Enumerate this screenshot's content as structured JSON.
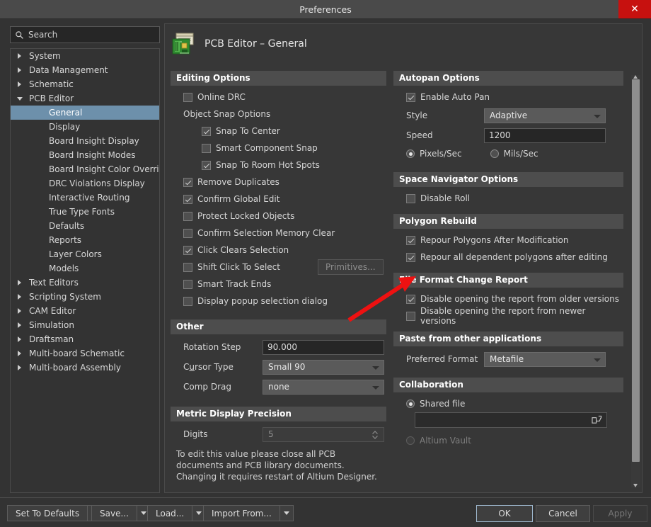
{
  "window": {
    "title": "Preferences",
    "close_label": "✕"
  },
  "search": {
    "placeholder": "Search",
    "value": "",
    "icon": "search-icon"
  },
  "sidebar": {
    "items": [
      {
        "label": "System",
        "level": 0,
        "expander": "closed",
        "selected": false
      },
      {
        "label": "Data Management",
        "level": 0,
        "expander": "closed",
        "selected": false
      },
      {
        "label": "Schematic",
        "level": 0,
        "expander": "closed",
        "selected": false
      },
      {
        "label": "PCB Editor",
        "level": 0,
        "expander": "open",
        "selected": false
      },
      {
        "label": "General",
        "level": 1,
        "expander": "none",
        "selected": true
      },
      {
        "label": "Display",
        "level": 1,
        "expander": "none",
        "selected": false
      },
      {
        "label": "Board Insight Display",
        "level": 1,
        "expander": "none",
        "selected": false
      },
      {
        "label": "Board Insight Modes",
        "level": 1,
        "expander": "none",
        "selected": false
      },
      {
        "label": "Board Insight Color Overrides",
        "level": 1,
        "expander": "none",
        "selected": false
      },
      {
        "label": "DRC Violations Display",
        "level": 1,
        "expander": "none",
        "selected": false
      },
      {
        "label": "Interactive Routing",
        "level": 1,
        "expander": "none",
        "selected": false
      },
      {
        "label": "True Type Fonts",
        "level": 1,
        "expander": "none",
        "selected": false
      },
      {
        "label": "Defaults",
        "level": 1,
        "expander": "none",
        "selected": false
      },
      {
        "label": "Reports",
        "level": 1,
        "expander": "none",
        "selected": false
      },
      {
        "label": "Layer Colors",
        "level": 1,
        "expander": "none",
        "selected": false
      },
      {
        "label": "Models",
        "level": 1,
        "expander": "none",
        "selected": false
      },
      {
        "label": "Text Editors",
        "level": 0,
        "expander": "closed",
        "selected": false
      },
      {
        "label": "Scripting System",
        "level": 0,
        "expander": "closed",
        "selected": false
      },
      {
        "label": "CAM Editor",
        "level": 0,
        "expander": "closed",
        "selected": false
      },
      {
        "label": "Simulation",
        "level": 0,
        "expander": "closed",
        "selected": false
      },
      {
        "label": "Draftsman",
        "level": 0,
        "expander": "closed",
        "selected": false
      },
      {
        "label": "Multi-board Schematic",
        "level": 0,
        "expander": "closed",
        "selected": false
      },
      {
        "label": "Multi-board Assembly",
        "level": 0,
        "expander": "closed",
        "selected": false
      }
    ]
  },
  "page": {
    "title": "PCB Editor – General",
    "icon": "pcb-board-icon"
  },
  "editing_options": {
    "header": "Editing Options",
    "online_drc": {
      "label": "Online DRC",
      "checked": false
    },
    "object_snap_label": "Object Snap Options",
    "snap_to_center": {
      "label": "Snap To Center",
      "checked": true
    },
    "smart_component_snap": {
      "label": "Smart Component Snap",
      "checked": false
    },
    "snap_to_room_hot_spots": {
      "label": "Snap To Room Hot Spots",
      "checked": true
    },
    "remove_duplicates": {
      "label": "Remove Duplicates",
      "checked": true
    },
    "confirm_global_edit": {
      "label": "Confirm Global Edit",
      "checked": true
    },
    "protect_locked_objects": {
      "label": "Protect Locked Objects",
      "checked": false
    },
    "confirm_selection_memory_clear": {
      "label": "Confirm Selection Memory Clear",
      "checked": false
    },
    "click_clears_selection": {
      "label": "Click Clears Selection",
      "checked": true
    },
    "shift_click_to_select": {
      "label": "Shift Click To Select",
      "checked": false
    },
    "primitives_button": {
      "label": "Primitives...",
      "enabled": false
    },
    "smart_track_ends": {
      "label": "Smart Track Ends",
      "checked": false
    },
    "display_popup_selection_dialog": {
      "label": "Display popup selection dialog",
      "checked": false
    }
  },
  "other": {
    "header": "Other",
    "rotation_step": {
      "label": "Rotation Step",
      "value": "90.000"
    },
    "cursor_type": {
      "label": "Cursor Type",
      "value": "Small 90"
    },
    "comp_drag": {
      "label": "Comp Drag",
      "value": "none"
    }
  },
  "metric_display_precision": {
    "header": "Metric Display Precision",
    "digits": {
      "label": "Digits",
      "value": "5",
      "enabled": false
    },
    "help_text": "To edit this value please close all PCB documents and PCB library documents. Changing it requires restart of Altium Designer."
  },
  "autopan_options": {
    "header": "Autopan Options",
    "enable_auto_pan": {
      "label": "Enable Auto Pan",
      "checked": true
    },
    "style": {
      "label": "Style",
      "value": "Adaptive"
    },
    "speed": {
      "label": "Speed",
      "value": "1200"
    },
    "pixels_per_sec": {
      "label": "Pixels/Sec",
      "selected": true
    },
    "mils_per_sec": {
      "label": "Mils/Sec",
      "selected": false
    }
  },
  "space_navigator_options": {
    "header": "Space Navigator Options",
    "disable_roll": {
      "label": "Disable Roll",
      "checked": false
    }
  },
  "polygon_rebuild": {
    "header": "Polygon Rebuild",
    "repour_after_modification": {
      "label": "Repour Polygons After Modification",
      "checked": true
    },
    "repour_dependent": {
      "label": "Repour all dependent polygons after editing",
      "checked": true
    }
  },
  "file_format_change_report": {
    "header": "File Format Change Report",
    "disable_older": {
      "label": "Disable opening the report from older versions",
      "checked": true
    },
    "disable_newer": {
      "label": "Disable opening the report from newer versions",
      "checked": false
    }
  },
  "paste_from_other_applications": {
    "header": "Paste from other applications",
    "preferred_format": {
      "label": "Preferred Format",
      "value": "Metafile"
    }
  },
  "collaboration": {
    "header": "Collaboration",
    "shared_file": {
      "label": "Shared file",
      "selected": true
    },
    "shared_file_path": {
      "value": "",
      "browse_icon": "folder-open-icon"
    },
    "altium_vault": {
      "label": "Altium Vault",
      "selected": false,
      "enabled": false
    }
  },
  "footer": {
    "set_to_defaults": "Set To Defaults",
    "save": "Save...",
    "load": "Load...",
    "import_from": "Import From...",
    "ok": "OK",
    "cancel": "Cancel",
    "apply": "Apply",
    "apply_enabled": false
  },
  "annotation": {
    "type": "red-arrow",
    "color": "#ee1111",
    "points": "from (492,452) to (586,392)"
  },
  "colors": {
    "window_bg": "#333333",
    "title_bar": "#4a4a4a",
    "section_header": "#4d4d4d",
    "selection": "#6d90ab",
    "close_button": "#c7110f",
    "accent_text": "#ffffff"
  }
}
